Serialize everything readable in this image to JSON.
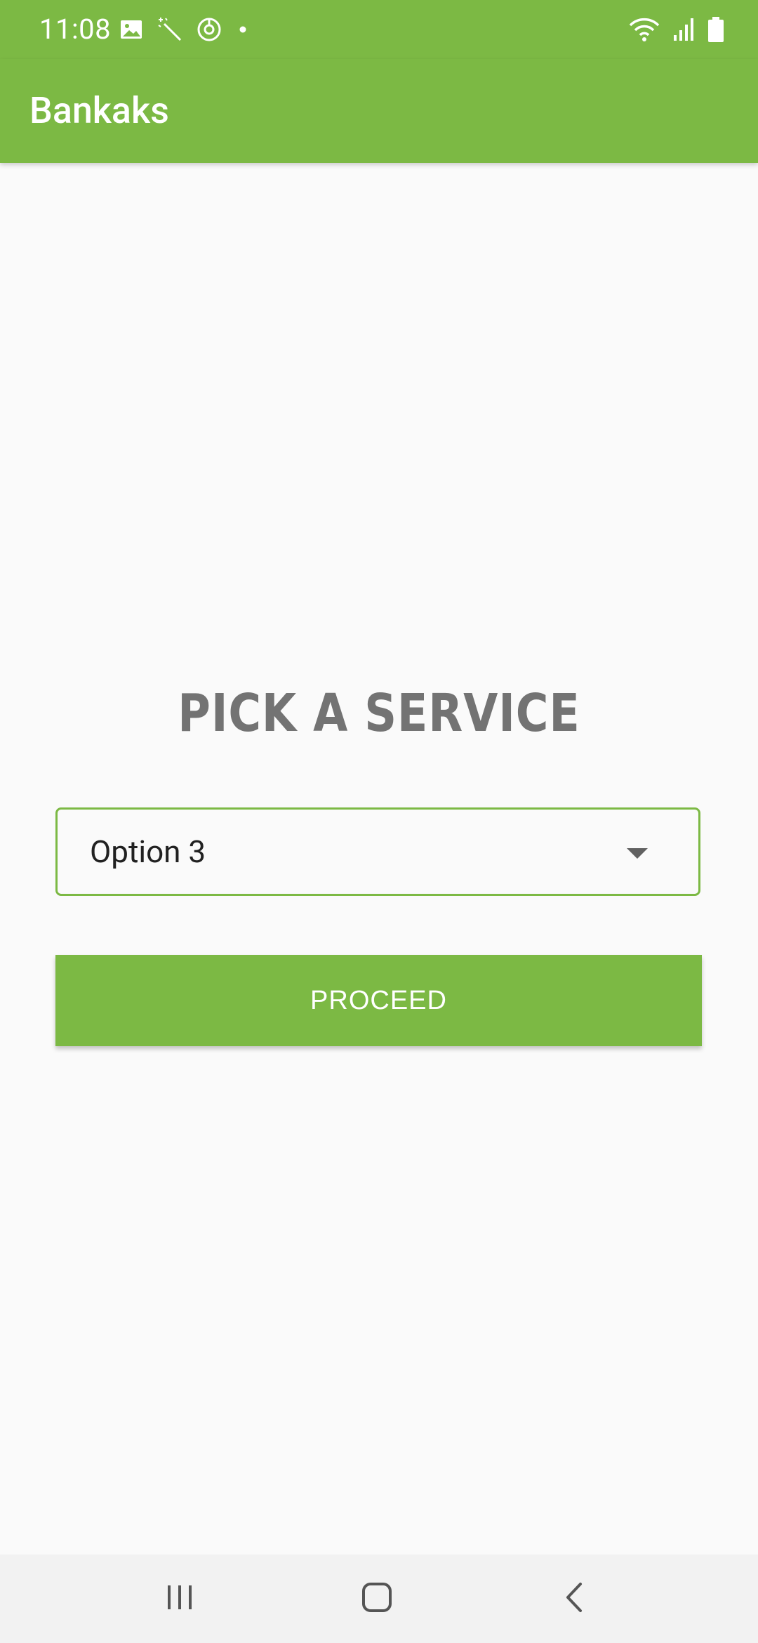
{
  "status_bar": {
    "time": "11:08",
    "left_icons": [
      "image-icon",
      "magic-wand-icon",
      "target-icon",
      "dot-icon"
    ],
    "right_icons": [
      "wifi-icon",
      "signal-icon",
      "battery-icon"
    ]
  },
  "app_bar": {
    "title": "Bankaks"
  },
  "main": {
    "heading": "PICK A SERVICE",
    "dropdown": {
      "selected_value": "Option 3"
    },
    "proceed_label": "PROCEED"
  },
  "nav_bar": {
    "items": [
      "recent-apps-icon",
      "home-icon",
      "back-icon"
    ]
  },
  "colors": {
    "accent": "#7cb944",
    "heading": "#737373",
    "background": "#fafafa",
    "nav_background": "#f2f2f2"
  }
}
